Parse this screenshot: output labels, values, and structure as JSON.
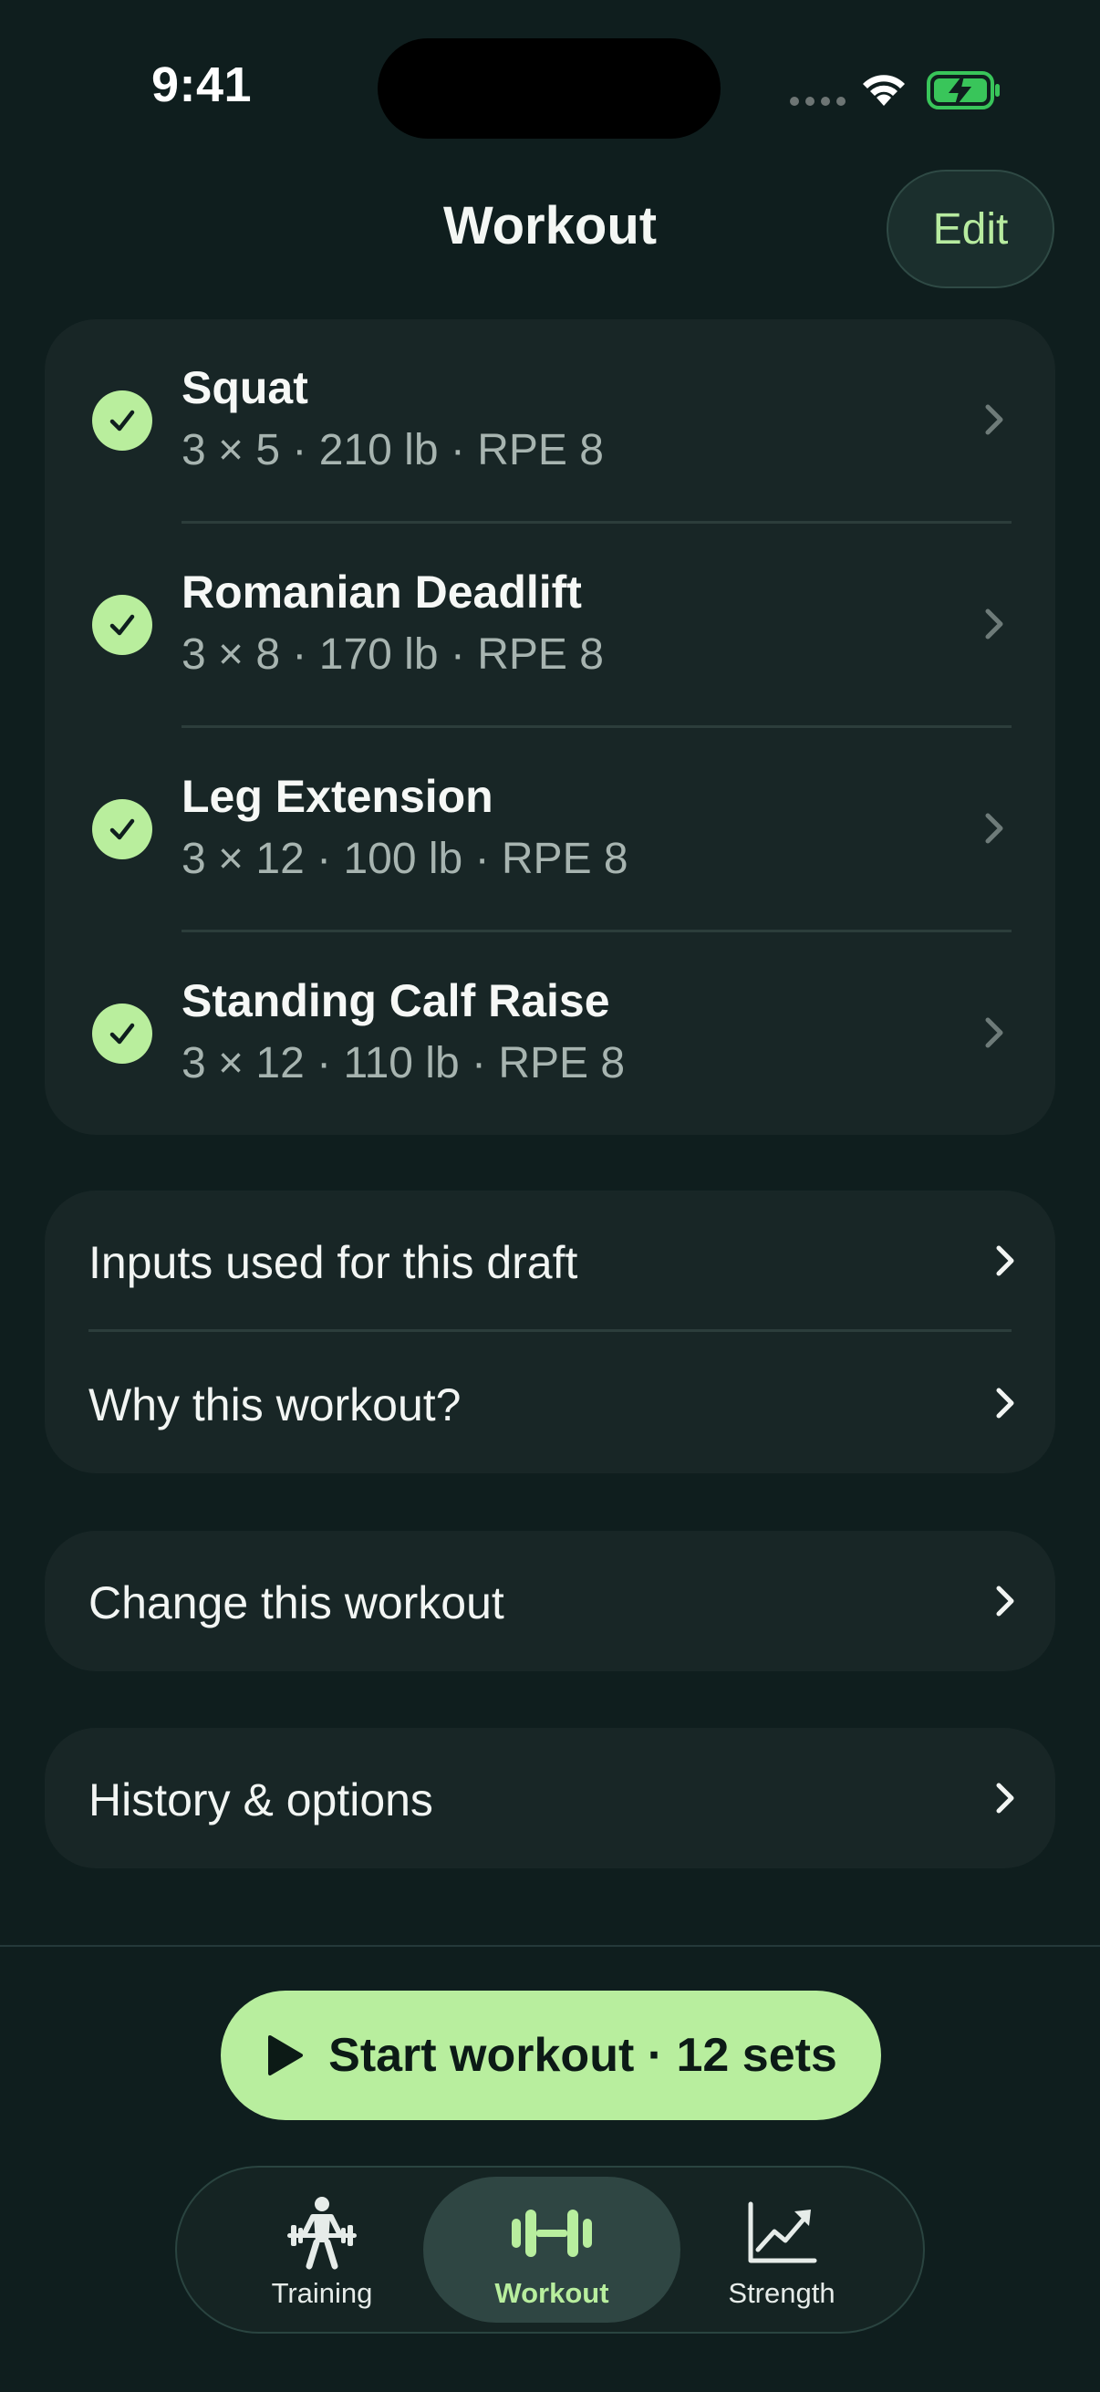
{
  "status": {
    "time": "9:41"
  },
  "header": {
    "title": "Workout",
    "edit_label": "Edit"
  },
  "exercises": [
    {
      "name": "Squat",
      "detail": "3 × 5 · 210 lb · RPE 8",
      "completed": true
    },
    {
      "name": "Romanian Deadlift",
      "detail": "3 × 8 · 170 lb · RPE 8",
      "completed": true
    },
    {
      "name": "Leg Extension",
      "detail": "3 × 12 · 100 lb · RPE 8",
      "completed": true
    },
    {
      "name": "Standing Calf Raise",
      "detail": "3 × 12 · 110 lb · RPE 8",
      "completed": true
    }
  ],
  "info_links": [
    {
      "label": "Inputs used for this draft"
    },
    {
      "label": "Why this workout?"
    }
  ],
  "change_link": {
    "label": "Change this workout"
  },
  "history_link": {
    "label": "History & options"
  },
  "start_button": {
    "label": "Start workout · 12 sets"
  },
  "tabs": [
    {
      "label": "Training",
      "icon": "weightlifter-icon",
      "active": false
    },
    {
      "label": "Workout",
      "icon": "dumbbell-icon",
      "active": true
    },
    {
      "label": "Strength",
      "icon": "trend-chart-icon",
      "active": false
    }
  ],
  "colors": {
    "background": "#0f1e1e",
    "card": "#182626",
    "accent": "#b8ee9e",
    "secondary_text": "#a7b4b0"
  }
}
